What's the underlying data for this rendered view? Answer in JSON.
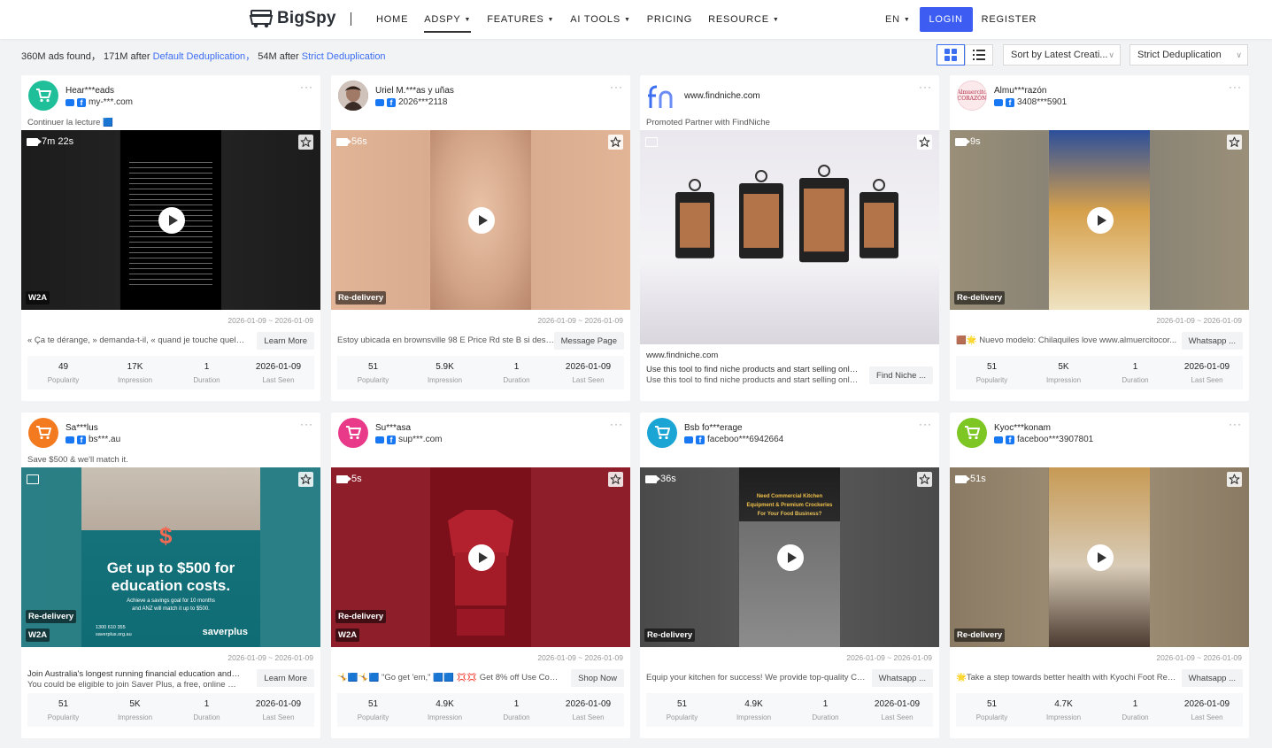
{
  "header": {
    "logo": "BigSpy",
    "nav": [
      {
        "label": "HOME",
        "caret": false,
        "active": false
      },
      {
        "label": "ADSPY",
        "caret": true,
        "active": true
      },
      {
        "label": "FEATURES",
        "caret": true,
        "active": false
      },
      {
        "label": "AI TOOLS",
        "caret": true,
        "active": false
      },
      {
        "label": "PRICING",
        "caret": false,
        "active": false
      },
      {
        "label": "RESOURCE",
        "caret": true,
        "active": false
      }
    ],
    "lang": "EN",
    "login": "LOGIN",
    "register": "REGISTER"
  },
  "toolbar": {
    "found": "360M ads found，",
    "after1": "171M after",
    "dedup1": "Default Deduplication，",
    "after2": "54M after",
    "dedup2": "Strict Deduplication",
    "sort": "Sort by Latest Creati...",
    "dedup_select": "Strict Deduplication"
  },
  "stat_labels": {
    "popularity": "Popularity",
    "impression": "Impression",
    "duration": "Duration",
    "last_seen": "Last Seen"
  },
  "cards": [
    {
      "name": "Hear***eads",
      "sub": "my-***.com",
      "avatar_color": "#1fbf9a",
      "avatar_type": "cart",
      "text": "Continuer la lecture 🟦",
      "media_type": "video",
      "duration": "7m 22s",
      "badge": "W2A",
      "badge2": "",
      "dates": "2026-01-09 ~ 2026-01-09",
      "desc": "« Ça te dérange, » demanda-t-il, « quand je touche quelqu'un...",
      "desc2": "",
      "cta": "Learn More",
      "stats": {
        "popularity": "49",
        "impression": "17K",
        "duration": "1",
        "last_seen": "2026-01-09"
      },
      "colors": [
        "#1c1c1c",
        "#000000",
        "#222222"
      ]
    },
    {
      "name": "Uriel M.***as y uñas",
      "sub": "2026***2118",
      "avatar_color": "#6b5d55",
      "avatar_type": "photo",
      "text": "",
      "media_type": "video",
      "duration": "56s",
      "badge": "Re-delivery",
      "badge2": "",
      "dates": "2026-01-09 ~ 2026-01-09",
      "desc": "Estoy ubicada en brownsville 98 E Price Rd ste B si desea m...",
      "desc2": "",
      "cta": "Message Page",
      "stats": {
        "popularity": "51",
        "impression": "5.9K",
        "duration": "1",
        "last_seen": "2026-01-09"
      },
      "colors": [
        "#e3b597",
        "#c99479",
        "#d9ab8f"
      ]
    },
    {
      "name": "www.findniche.com",
      "sub": "",
      "avatar_color": "#ffffff",
      "avatar_type": "fn",
      "text": "Promoted Partner with FindNiche",
      "media_type": "image",
      "duration": "",
      "badge": "",
      "badge2": "",
      "dates": "",
      "link": "www.findniche.com",
      "desc": "Use this tool to find niche products and start selling online.",
      "desc2": "Use this tool to find niche products and start selling online.",
      "cta": "Find Niche ...",
      "stats": {},
      "colors": [
        "#c9c2c8",
        "#e8e6ec",
        "#cfc9cf"
      ]
    },
    {
      "name": "Almu***razón",
      "sub": "3408***5901",
      "avatar_color": "#fbe9ec",
      "avatar_type": "logo",
      "text": "",
      "media_type": "video",
      "duration": "9s",
      "badge": "Re-delivery",
      "badge2": "",
      "dates": "2026-01-09 ~ 2026-01-09",
      "desc": "🟫🌟 Nuevo modelo: Chilaquiles love www.almuercitocor...",
      "desc2": "",
      "cta": "Whatsapp ...",
      "stats": {
        "popularity": "51",
        "impression": "5K",
        "duration": "1",
        "last_seen": "2026-01-09"
      },
      "colors": [
        "#9a8f78",
        "#c7a26a",
        "#8a8476"
      ]
    },
    {
      "name": "Sa***lus",
      "sub": "bs***.au",
      "avatar_color": "#f47a20",
      "avatar_type": "cart",
      "text": "Save $500 & we'll match it.",
      "media_type": "image",
      "duration": "",
      "badge": "Re-delivery",
      "badge2": "W2A",
      "dates": "2026-01-09 ~ 2026-01-09",
      "desc": "Join Australia's longest running financial education and match...",
      "desc2": "You could be eligible to join Saver Plus, a free, online program...",
      "cta": "Learn More",
      "stats": {
        "popularity": "51",
        "impression": "5K",
        "duration": "1",
        "last_seen": "2026-01-09"
      },
      "colors": [
        "#2a7f86",
        "#127177",
        "#2b7f85"
      ],
      "headline": "Get up to $500 for education costs.",
      "small1": "Achieve a savings goal for 10 months",
      "small2": "and ANZ will match it up to $500.",
      "phone": "1300 610 355",
      "site": "saverplus.org.au",
      "brand": "saverplus"
    },
    {
      "name": "Su***asa",
      "sub": "sup***.com",
      "avatar_color": "#e93a8a",
      "avatar_type": "cart",
      "text": "",
      "media_type": "video",
      "duration": "5s",
      "badge": "Re-delivery",
      "badge2": "W2A",
      "dates": "2026-01-09 ~ 2026-01-09",
      "desc": "🤸🟦🤸🟦 \"Go get 'em,\" 🟦🟦 💢💢 Get 8% off Use Code YD0...",
      "desc2": "",
      "cta": "Shop Now",
      "stats": {
        "popularity": "51",
        "impression": "4.9K",
        "duration": "1",
        "last_seen": "2026-01-09"
      },
      "colors": [
        "#8e1f2a",
        "#7b0f1a",
        "#8e1f2a"
      ]
    },
    {
      "name": "Bsb fo***erage",
      "sub": "faceboo***6942664",
      "avatar_color": "#1aa5d4",
      "avatar_type": "cart",
      "text": "",
      "media_type": "video",
      "duration": "36s",
      "badge": "Re-delivery",
      "badge2": "",
      "dates": "2026-01-09 ~ 2026-01-09",
      "desc": "Equip your kitchen for success! We provide top-quality Co...",
      "desc2": "",
      "cta": "Whatsapp ...",
      "stats": {
        "popularity": "51",
        "impression": "4.9K",
        "duration": "1",
        "last_seen": "2026-01-09"
      },
      "colors": [
        "#4a4a4a",
        "#5a5a5a",
        "#555555"
      ],
      "overlay1": "Need Commercial Kitchen",
      "overlay2": "Equipment & Premium Crockeries",
      "overlay3": "For Your Food Business?"
    },
    {
      "name": "Kyoc***konam",
      "sub": "faceboo***3907801",
      "avatar_color": "#7ec623",
      "avatar_type": "cart",
      "text": "",
      "media_type": "video",
      "duration": "51s",
      "badge": "Re-delivery",
      "badge2": "",
      "dates": "2026-01-09 ~ 2026-01-09",
      "desc": "🌟Take a step towards better health with Kyochi Foot Refle...",
      "desc2": "",
      "cta": "Whatsapp ...",
      "stats": {
        "popularity": "51",
        "impression": "4.7K",
        "duration": "1",
        "last_seen": "2026-01-09"
      },
      "colors": [
        "#8a7a63",
        "#b38a4a",
        "#9a8a72"
      ]
    }
  ]
}
